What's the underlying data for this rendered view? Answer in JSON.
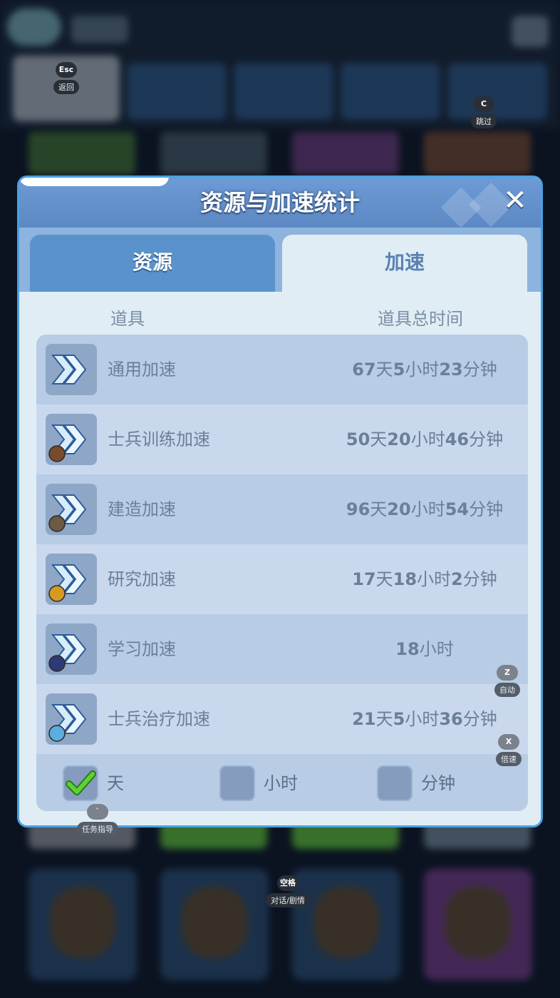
{
  "dialog": {
    "title": "资源与加速统计",
    "close_glyph": "✕",
    "tabs": [
      {
        "label": "资源",
        "state": "inactive"
      },
      {
        "label": "加速",
        "state": "active"
      }
    ],
    "columns": {
      "item": "道具",
      "total_time": "道具总时间"
    },
    "items": [
      {
        "name": "通用加速",
        "icon": "general-speedup-icon",
        "time": [
          [
            "67",
            "天"
          ],
          [
            "5",
            "小时"
          ],
          [
            "23",
            "分钟"
          ]
        ]
      },
      {
        "name": "士兵训练加速",
        "icon": "training-speedup-icon",
        "time": [
          [
            "50",
            "天"
          ],
          [
            "20",
            "小时"
          ],
          [
            "46",
            "分钟"
          ]
        ]
      },
      {
        "name": "建造加速",
        "icon": "construction-speedup-icon",
        "time": [
          [
            "96",
            "天"
          ],
          [
            "20",
            "小时"
          ],
          [
            "54",
            "分钟"
          ]
        ]
      },
      {
        "name": "研究加速",
        "icon": "research-speedup-icon",
        "time": [
          [
            "17",
            "天"
          ],
          [
            "18",
            "小时"
          ],
          [
            "2",
            "分钟"
          ]
        ]
      },
      {
        "name": "学习加速",
        "icon": "learning-speedup-icon",
        "time": [
          [
            "18",
            "小时"
          ]
        ]
      },
      {
        "name": "士兵治疗加速",
        "icon": "healing-speedup-icon",
        "time": [
          [
            "21",
            "天"
          ],
          [
            "5",
            "小时"
          ],
          [
            "36",
            "分钟"
          ]
        ]
      }
    ],
    "units": [
      {
        "label": "天",
        "checked": true
      },
      {
        "label": "小时",
        "checked": false
      },
      {
        "label": "分钟",
        "checked": false
      }
    ]
  },
  "hotkeys": {
    "back": {
      "key": "Esc",
      "label": "返回"
    },
    "skip": {
      "key": "C",
      "label": "跳过"
    },
    "auto": {
      "key": "Z",
      "label": "自动"
    },
    "speed": {
      "key": "X",
      "label": "倍速"
    },
    "guide": {
      "key": "`",
      "label": "任务指导"
    },
    "dialogue": {
      "key": "空格",
      "label": "对话/剧情"
    }
  },
  "colors": {
    "accent_border": "#4aa0e0",
    "header_blue": "#5c88c4",
    "text_muted": "#6a7f98",
    "check_green": "#4fb82c"
  }
}
